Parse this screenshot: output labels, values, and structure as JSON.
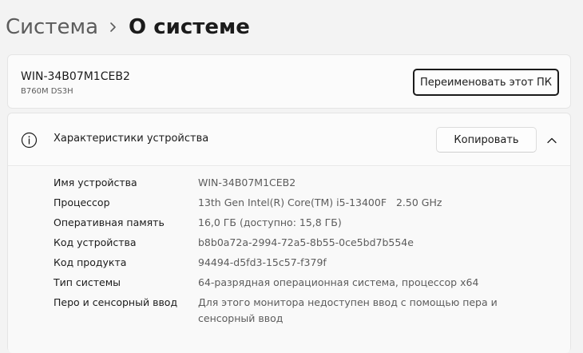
{
  "breadcrumb": {
    "parent": "Система",
    "separator_icon": "chevron-right-icon",
    "current": "О системе"
  },
  "pc": {
    "name": "WIN-34B07M1CEB2",
    "model": "B760M DS3H",
    "rename_label": "Переименовать этот ПК"
  },
  "specs": {
    "title": "Характеристики устройства",
    "copy_label": "Копировать",
    "icons": {
      "info": "info-icon",
      "collapse": "chevron-up-icon"
    },
    "rows": [
      {
        "label": "Имя устройства",
        "value": "WIN-34B07M1CEB2"
      },
      {
        "label": "Процессор",
        "value": "13th Gen Intel(R) Core(TM) i5-13400F   2.50 GHz"
      },
      {
        "label": "Оперативная память",
        "value": "16,0 ГБ (доступно: 15,8 ГБ)"
      },
      {
        "label": "Код устройства",
        "value": "b8b0a72a-2994-72a5-8b55-0ce5bd7b554e"
      },
      {
        "label": "Код продукта",
        "value": "94494-d5fd3-15c57-f379f"
      },
      {
        "label": "Тип системы",
        "value": "64-разрядная операционная система, процессор x64"
      },
      {
        "label": "Перо и сенсорный ввод",
        "value": "Для этого монитора недоступен ввод с помощью пера и сенсорный ввод"
      }
    ]
  },
  "colors": {
    "background": "#f3f3f3",
    "card": "#fbfbfb",
    "text_primary": "#1b1b1b",
    "text_secondary": "#5c5c5c"
  }
}
